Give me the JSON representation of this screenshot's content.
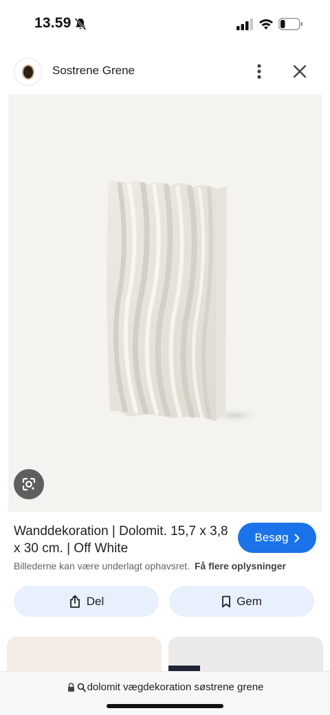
{
  "status_bar": {
    "time": "13.59",
    "icons": [
      "bell-slash-icon",
      "signal-icon",
      "wifi-icon",
      "battery-icon"
    ]
  },
  "header": {
    "site_name": "Sostrene Grene",
    "icons": [
      "avatar-logo",
      "more-vert-icon",
      "close-icon"
    ]
  },
  "product": {
    "title": "Wanddekoration | Dolomit. 15,7 x 3,8 x 30 cm. | Off White",
    "visit_label": "Besøg",
    "copyright_note": "Billederne kan være underlagt ophavsret.",
    "more_info_link": "Få flere oplysninger",
    "image_subject": "white wavy wall decoration panel"
  },
  "actions": {
    "share_label": "Del",
    "save_label": "Gem"
  },
  "bottom_bar": {
    "url_text": "dolomit vægdekoration søstrene grene"
  },
  "colors": {
    "accent": "#1a73e8",
    "chip_bg": "#e8f0fe",
    "image_bg": "#f4f3ef"
  }
}
